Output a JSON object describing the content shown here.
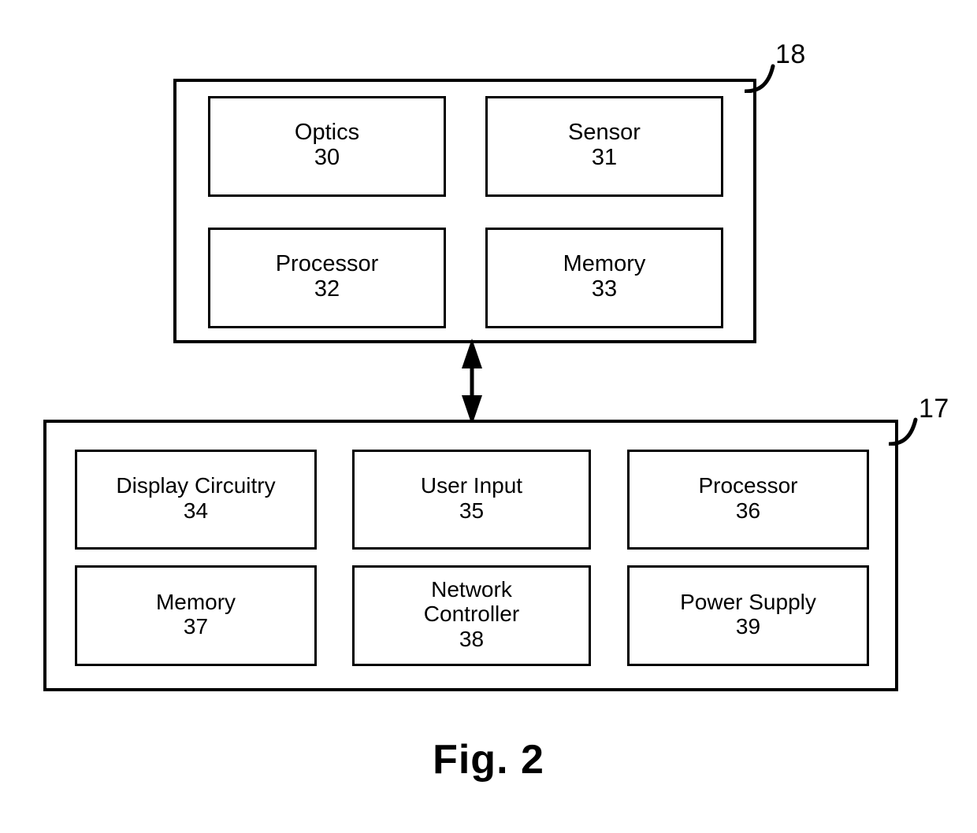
{
  "figure": {
    "caption": "Fig. 2",
    "title": "Fig. 2"
  },
  "colors": {
    "stroke": "#000000",
    "background": "#ffffff",
    "text": "#000000"
  },
  "camera_module": {
    "reference_numeral": "18",
    "blocks": [
      {
        "label": "Optics",
        "ref": "30"
      },
      {
        "label": "Sensor",
        "ref": "31"
      },
      {
        "label": "Processor",
        "ref": "32"
      },
      {
        "label": "Memory",
        "ref": "33"
      }
    ]
  },
  "host_device": {
    "reference_numeral": "17",
    "blocks": [
      {
        "label": "Display Circuitry",
        "ref": "34"
      },
      {
        "label": "User Input",
        "ref": "35"
      },
      {
        "label": "Processor",
        "ref": "36"
      },
      {
        "label": "Memory",
        "ref": "37"
      },
      {
        "label": "Network\nController",
        "ref": "38"
      },
      {
        "label": "Power Supply",
        "ref": "39"
      }
    ]
  },
  "connector": {
    "type": "double-headed-arrow",
    "orientation": "vertical",
    "from": "camera_module",
    "to": "host_device"
  }
}
